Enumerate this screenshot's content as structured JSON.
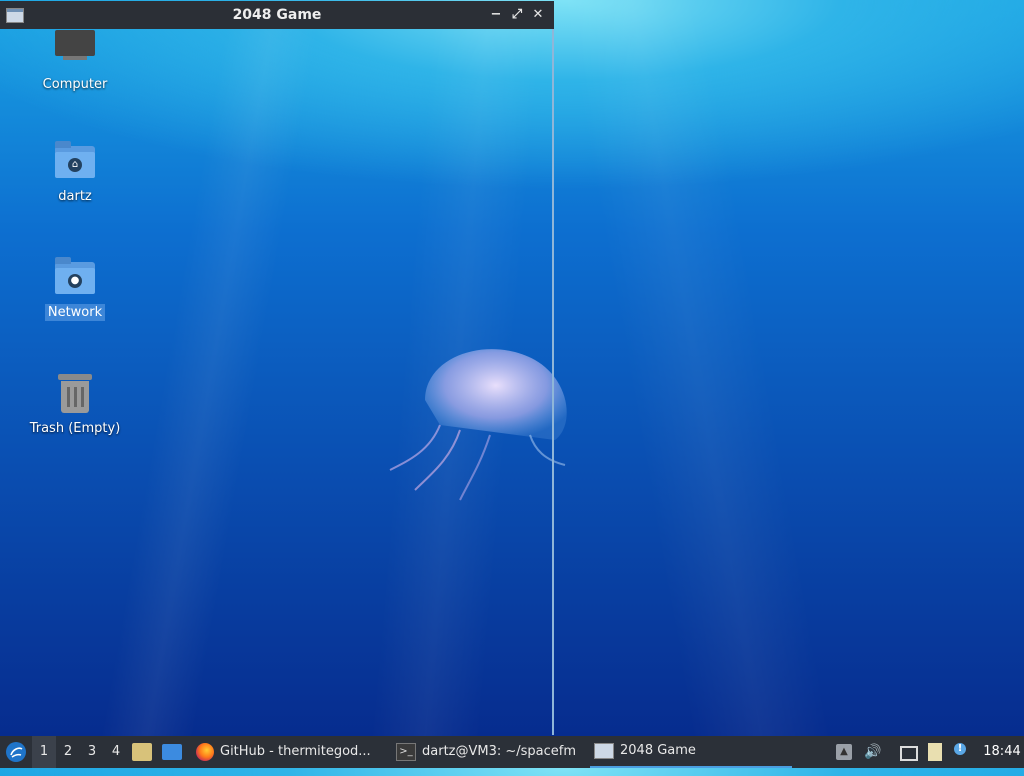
{
  "window": {
    "title": "2048 Game"
  },
  "desktop": {
    "icons": [
      {
        "label": "Computer",
        "icon": "computer-icon"
      },
      {
        "label": "dartz",
        "icon": "home-folder-icon"
      },
      {
        "label": "Network",
        "icon": "network-folder-icon",
        "selected": true
      },
      {
        "label": "Trash (Empty)",
        "icon": "trash-icon"
      }
    ]
  },
  "taskbar": {
    "workspaces": [
      "1",
      "2",
      "3",
      "4"
    ],
    "active_workspace": "1",
    "tasks": [
      {
        "label": "GitHub - thermitegod...",
        "icon": "firefox-icon"
      },
      {
        "label": "dartz@VM3: ~/spacefm",
        "icon": "terminal-icon"
      },
      {
        "label": "2048 Game",
        "icon": "window-icon",
        "active": true
      }
    ],
    "clock": "18:44"
  },
  "colors": {
    "accent": "#3d86d8",
    "taskbar": "#2b3038",
    "titlebar": "#2b2f36"
  }
}
